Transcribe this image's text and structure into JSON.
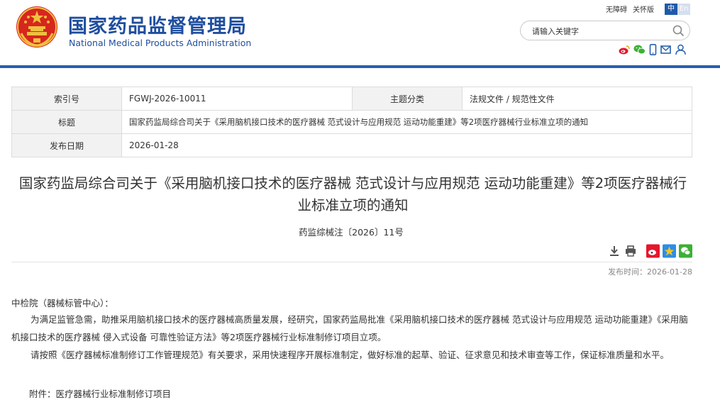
{
  "header": {
    "site_name_cn": "国家药品监督管理局",
    "site_name_en": "National Medical Products Administration",
    "utility_links": {
      "accessibility": "无障碍",
      "care_mode": "关怀版"
    },
    "lang": {
      "zh": "中",
      "en": "En"
    },
    "search": {
      "placeholder": "请输入关键字",
      "value": ""
    },
    "share_icons": [
      "weibo-icon",
      "wechat-icon",
      "mobile-icon",
      "mail-icon",
      "user-icon"
    ]
  },
  "info": {
    "index_label": "索引号",
    "index_value": "FGWJ-2026-10011",
    "category_label": "主题分类",
    "category_value": "法规文件 / 规范性文件",
    "title_label": "标题",
    "title_value": "国家药监局综合司关于《采用脑机接口技术的医疗器械 范式设计与应用规范 运动功能重建》等2项医疗器械行业标准立项的通知",
    "date_label": "发布日期",
    "date_value": "2026-01-28"
  },
  "article": {
    "title": "国家药监局综合司关于《采用脑机接口技术的医疗器械 范式设计与应用规范 运动功能重建》等2项医疗器械行业标准立项的通知",
    "doc_number": "药监综械注〔2026〕11号",
    "publish_time": "发布时间：2026-01-28",
    "recipient": "中检院（器械标管中心）：",
    "paragraphs": [
      "为满足监管急需，助推采用脑机接口技术的医疗器械高质量发展，经研究，国家药监局批准《采用脑机接口技术的医疗器械 范式设计与应用规范 运动功能重建》《采用脑机接口技术的医疗器械 侵入式设备 可靠性验证方法》等2项医疗器械行业标准制修订项目立项。",
      "请按照《医疗器械标准制修订工作管理规范》有关要求，采用快速程序开展标准制定，做好标准的起草、验证、征求意见和技术审查等工作，保证标准质量和水平。"
    ],
    "attachment": "附件：医疗器械行业标准制修订项目"
  },
  "colors": {
    "brand_blue": "#1f4e9e",
    "rule_blue": "#2660ad",
    "emblem_red": "#d7261e",
    "gold": "#f0c040"
  }
}
